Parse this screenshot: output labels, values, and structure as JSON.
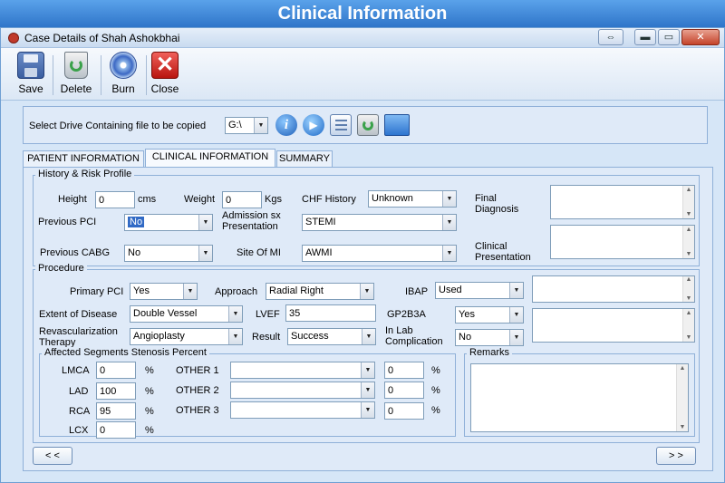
{
  "banner": {
    "title": "Clinical Information"
  },
  "window": {
    "title": "Case Details of Shah Ashokbhai",
    "btn_restore": "⇔",
    "btn_min": "▬",
    "btn_max": "▭",
    "btn_close": "✕"
  },
  "toolbar": {
    "save": "Save",
    "delete": "Delete",
    "burn": "Burn",
    "close": "Close"
  },
  "drive": {
    "label": "Select Drive Containing file to be copied",
    "value": "G:\\",
    "info_glyph": "i",
    "play_glyph": "▶"
  },
  "tabs": [
    {
      "label": "PATIENT INFORMATION"
    },
    {
      "label": "CLINICAL INFORMATION"
    },
    {
      "label": "SUMMARY"
    }
  ],
  "history": {
    "legend": "History & Risk Profile",
    "height_label": "Height",
    "height_value": "0",
    "height_unit": "cms",
    "weight_label": "Weight",
    "weight_value": "0",
    "weight_unit": "Kgs",
    "chf_label": "CHF History",
    "chf_value": "Unknown",
    "final_diagnosis_label": "Final Diagnosis",
    "final_diagnosis_value": "",
    "pci_label": "Previous PCI",
    "pci_value": "No",
    "admission_label": "Admission sx Presentation",
    "admission_value": "STEMI",
    "cabg_label": "Previous CABG",
    "cabg_value": "No",
    "site_label": "Site Of MI",
    "site_value": "AWMI",
    "clinical_presentation_label": "Clinical Presentation",
    "clinical_presentation_value": ""
  },
  "procedure": {
    "legend": "Procedure",
    "primary_pci_label": "Primary PCI",
    "primary_pci_value": "Yes",
    "approach_label": "Approach",
    "approach_value": "Radial Right",
    "ibap_label": "IBAP",
    "ibap_value": "Used",
    "ibap_note": "",
    "extent_label": "Extent of Disease",
    "extent_value": "Double Vessel",
    "lvef_label": "LVEF",
    "lvef_value": "35",
    "gp2b3a_label": "GP2B3A",
    "gp2b3a_value": "Yes",
    "complication_note": "",
    "revasc_label": "Revascularization Therapy",
    "revasc_value": "Angioplasty",
    "result_label": "Result",
    "result_value": "Success",
    "inlab_label": "In Lab Complication",
    "inlab_value": "No"
  },
  "segments": {
    "legend": "Affected Segments Stenosis Percent",
    "pct": "%",
    "lmca_label": "LMCA",
    "lmca_value": "0",
    "lad_label": "LAD",
    "lad_value": "100",
    "rca_label": "RCA",
    "rca_value": "95",
    "lcx_label": "LCX",
    "lcx_value": "0",
    "other1_label": "OTHER 1",
    "other1_select": "",
    "other1_value": "0",
    "other2_label": "OTHER 2",
    "other2_select": "",
    "other2_value": "0",
    "other3_label": "OTHER 3",
    "other3_select": "",
    "other3_value": "0"
  },
  "remarks": {
    "legend": "Remarks",
    "value": ""
  },
  "nav": {
    "prev": "< <",
    "next": "> >"
  },
  "colors": {
    "banner": "#2f75c9",
    "window_bg": "#d6e6f7",
    "panel_bg": "#dfeaf8",
    "border": "#8fb0d8",
    "selection": "#316ac5"
  },
  "icons": {
    "save": "floppy-disk-icon",
    "delete": "recycle-bin-icon",
    "burn": "cd-burn-icon",
    "close": "red-x-icon"
  }
}
